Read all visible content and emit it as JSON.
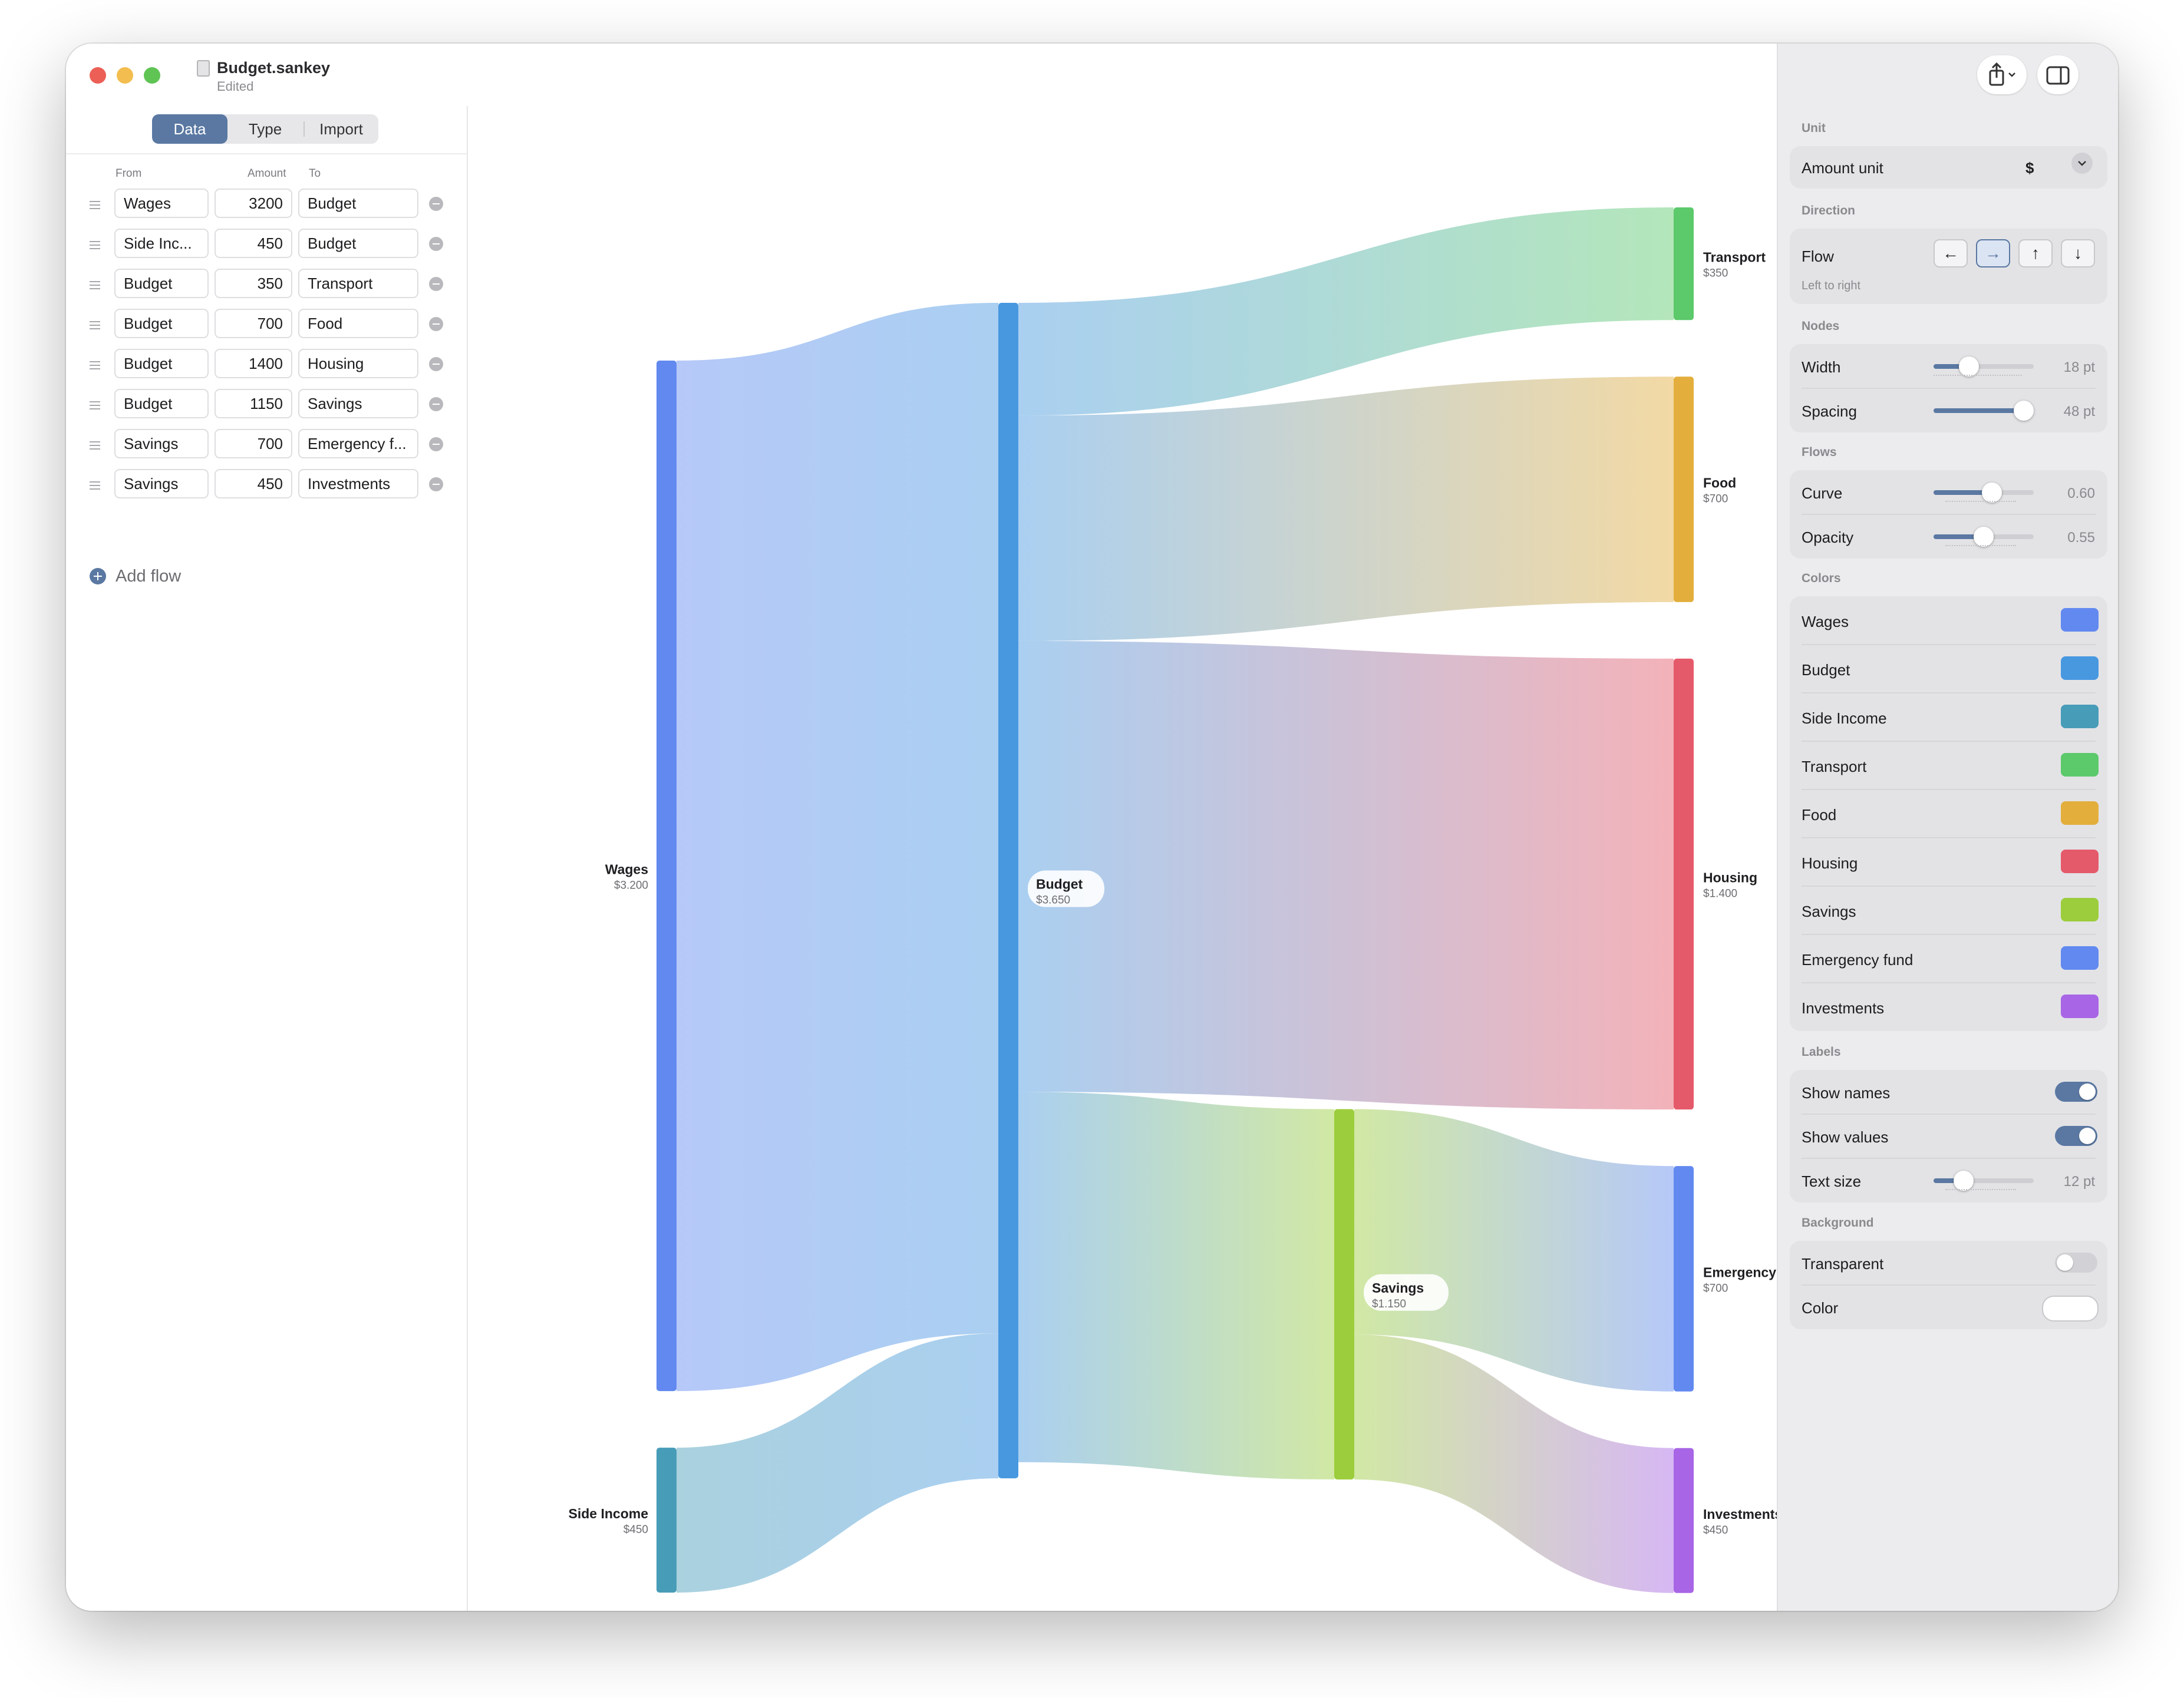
{
  "window": {
    "title": "Budget.sankey",
    "status": "Edited"
  },
  "tabs": [
    "Data",
    "Type",
    "Import"
  ],
  "table": {
    "headers": {
      "from": "From",
      "amount": "Amount",
      "to": "To"
    },
    "rows": [
      {
        "from": "Wages",
        "amount": "3200",
        "to": "Budget"
      },
      {
        "from": "Side Inc...",
        "amount": "450",
        "to": "Budget"
      },
      {
        "from": "Budget",
        "amount": "350",
        "to": "Transport"
      },
      {
        "from": "Budget",
        "amount": "700",
        "to": "Food"
      },
      {
        "from": "Budget",
        "amount": "1400",
        "to": "Housing"
      },
      {
        "from": "Budget",
        "amount": "1150",
        "to": "Savings"
      },
      {
        "from": "Savings",
        "amount": "700",
        "to": "Emergency f..."
      },
      {
        "from": "Savings",
        "amount": "450",
        "to": "Investments"
      }
    ],
    "add_flow": "Add flow"
  },
  "chart_data": {
    "type": "sankey",
    "nodes": [
      {
        "name": "Wages",
        "label": "$3.200",
        "value": 3200,
        "column": 0,
        "color": "#6289f0"
      },
      {
        "name": "Side Income",
        "label": "$450",
        "value": 450,
        "column": 0,
        "color": "#479cb8"
      },
      {
        "name": "Budget",
        "label": "$3.650",
        "value": 3650,
        "column": 1,
        "color": "#4898e0"
      },
      {
        "name": "Savings",
        "label": "$1.150",
        "value": 1150,
        "column": 2,
        "color": "#9ccd3c"
      },
      {
        "name": "Transport",
        "label": "$350",
        "value": 350,
        "column": 3,
        "color": "#5cc96b"
      },
      {
        "name": "Food",
        "label": "$700",
        "value": 700,
        "column": 3,
        "color": "#e3ae3c"
      },
      {
        "name": "Housing",
        "label": "$1.400",
        "value": 1400,
        "column": 3,
        "color": "#e55a6a"
      },
      {
        "name": "Emergency fund",
        "label": "$700",
        "value": 700,
        "column": 3,
        "color": "#6289f0"
      },
      {
        "name": "Investments",
        "label": "$450",
        "value": 450,
        "column": 3,
        "color": "#a865e6"
      }
    ],
    "links": [
      {
        "source": "Wages",
        "target": "Budget",
        "value": 3200
      },
      {
        "source": "Side Income",
        "target": "Budget",
        "value": 450
      },
      {
        "source": "Budget",
        "target": "Transport",
        "value": 350
      },
      {
        "source": "Budget",
        "target": "Food",
        "value": 700
      },
      {
        "source": "Budget",
        "target": "Housing",
        "value": 1400
      },
      {
        "source": "Budget",
        "target": "Savings",
        "value": 1150
      },
      {
        "source": "Savings",
        "target": "Emergency fund",
        "value": 700
      },
      {
        "source": "Savings",
        "target": "Investments",
        "value": 450
      }
    ]
  },
  "inspector": {
    "unit": {
      "section": "Unit",
      "label": "Amount unit",
      "value": "$"
    },
    "direction": {
      "section": "Direction",
      "label": "Flow",
      "sub": "Left to right",
      "buttons": [
        "←",
        "→",
        "↑",
        "↓"
      ],
      "selected_index": 1
    },
    "nodes": {
      "section": "Nodes",
      "width": {
        "label": "Width",
        "value": "18 pt",
        "fraction": 0.35
      },
      "spacing": {
        "label": "Spacing",
        "value": "48 pt",
        "fraction": 0.9
      }
    },
    "flows": {
      "section": "Flows",
      "curve": {
        "label": "Curve",
        "value": "0.60",
        "fraction": 0.58
      },
      "opacity": {
        "label": "Opacity",
        "value": "0.55",
        "fraction": 0.5
      }
    },
    "colors": {
      "section": "Colors",
      "items": [
        {
          "name": "Wages",
          "color": "#6289f0"
        },
        {
          "name": "Budget",
          "color": "#4898e0"
        },
        {
          "name": "Side Income",
          "color": "#479cb8"
        },
        {
          "name": "Transport",
          "color": "#5cc96b"
        },
        {
          "name": "Food",
          "color": "#e3ae3c"
        },
        {
          "name": "Housing",
          "color": "#e55a6a"
        },
        {
          "name": "Savings",
          "color": "#9ccd3c"
        },
        {
          "name": "Emergency fund",
          "color": "#6289f0"
        },
        {
          "name": "Investments",
          "color": "#a865e6"
        }
      ]
    },
    "labels": {
      "section": "Labels",
      "show_names": {
        "label": "Show names",
        "on": true
      },
      "show_values": {
        "label": "Show values",
        "on": true
      },
      "text_size": {
        "label": "Text size",
        "value": "12 pt",
        "fraction": 0.3
      }
    },
    "background": {
      "section": "Background",
      "transparent": {
        "label": "Transparent",
        "on": false
      },
      "color": {
        "label": "Color",
        "value": "#ffffff"
      }
    }
  }
}
